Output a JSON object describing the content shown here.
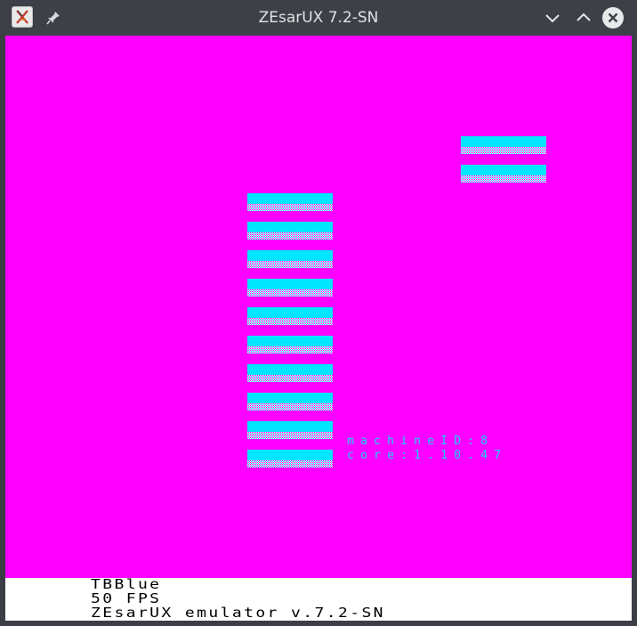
{
  "window": {
    "title": "ZEsarUX 7.2-SN",
    "icons": [
      "app-icon",
      "pin-icon",
      "minimize-icon",
      "maximize-icon",
      "close-icon"
    ]
  },
  "screen": {
    "colors": {
      "paper": "#ff00ff",
      "ink": "#00e6ff"
    },
    "info_lines": [
      "machineID:8",
      "core:1.10.47"
    ]
  },
  "status": {
    "lines": [
      "TBBlue",
      "50 FPS",
      "ZEsarUX emulator v.7.2-SN"
    ]
  }
}
